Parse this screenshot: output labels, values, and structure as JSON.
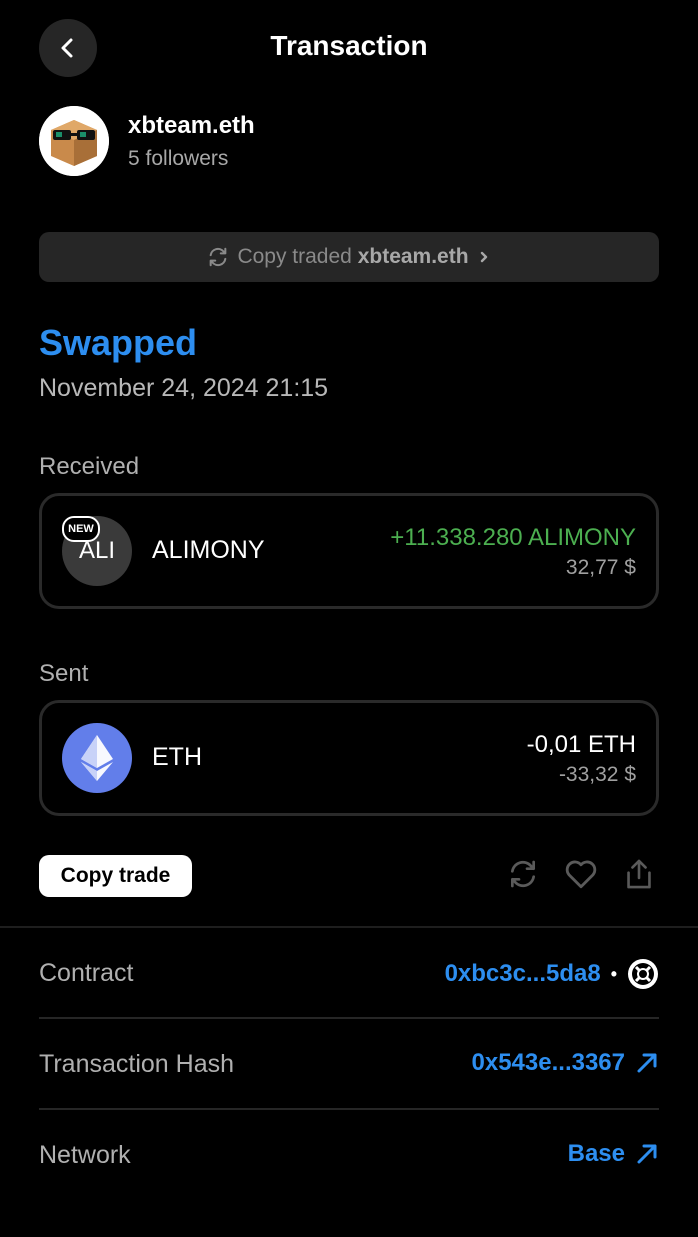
{
  "header": {
    "title": "Transaction"
  },
  "profile": {
    "username": "xbteam.eth",
    "followers": "5 followers"
  },
  "copy_traded": {
    "prefix": "Copy traded",
    "name": "xbteam.eth"
  },
  "status": {
    "label": "Swapped",
    "date": "November 24, 2024 21:15"
  },
  "received": {
    "label": "Received",
    "token": {
      "icon_text": "ALI",
      "badge": "NEW",
      "name": "ALIMONY",
      "amount": "+11.338.280 ALIMONY",
      "usd": "32,77 $",
      "amount_color": "#4caf50"
    }
  },
  "sent": {
    "label": "Sent",
    "token": {
      "name": "ETH",
      "amount": "-0,01 ETH",
      "usd": "-33,32 $",
      "icon": "ethereum-icon"
    }
  },
  "actions": {
    "copy_trade_label": "Copy trade",
    "icons": [
      "repeat-icon",
      "heart-icon",
      "share-icon"
    ]
  },
  "details": {
    "contract_label": "Contract",
    "contract_value": "0xbc3c...5da8",
    "hash_label": "Transaction Hash",
    "hash_value": "0x543e...3367",
    "network_label": "Network",
    "network_value": "Base"
  },
  "colors": {
    "accent": "#2d8ef0",
    "positive": "#4caf50",
    "background": "#000000"
  }
}
